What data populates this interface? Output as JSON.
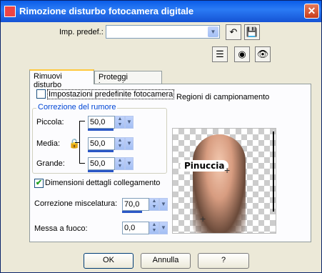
{
  "window": {
    "title": "Rimozione disturbo fotocamera digitale",
    "close_glyph": "✕"
  },
  "preset": {
    "label": "Imp. predef.:",
    "value": ""
  },
  "tabs": [
    {
      "label": "Rimuovi disturbo"
    },
    {
      "label": "Proteggi immagine"
    }
  ],
  "defaults_checkbox": {
    "label": "Impostazioni predefinite fotocamera",
    "checked": false
  },
  "noise_group": {
    "title": "Correzione del rumore",
    "small": {
      "label": "Piccola:",
      "value": "50,0"
    },
    "medium": {
      "label": "Media:",
      "value": "50,0"
    },
    "large": {
      "label": "Grande:",
      "value": "50,0"
    }
  },
  "link_checkbox": {
    "label": "Dimensioni dettagli collegamento",
    "checked": true,
    "mark": "✔"
  },
  "blend": {
    "label": "Correzione miscelatura:",
    "value": "70,0"
  },
  "focus": {
    "label": "Messa a fuoco:",
    "value": "0,0"
  },
  "sample_regions": {
    "label": "Regioni di campionamento",
    "watermark": "Pinuccia"
  },
  "buttons": {
    "ok": "OK",
    "cancel": "Annulla",
    "help": "?"
  },
  "icons": [
    "undo-icon",
    "save-icon",
    "list-icon",
    "eye-reset-icon",
    "eye-preview-icon",
    "lock-icon"
  ]
}
